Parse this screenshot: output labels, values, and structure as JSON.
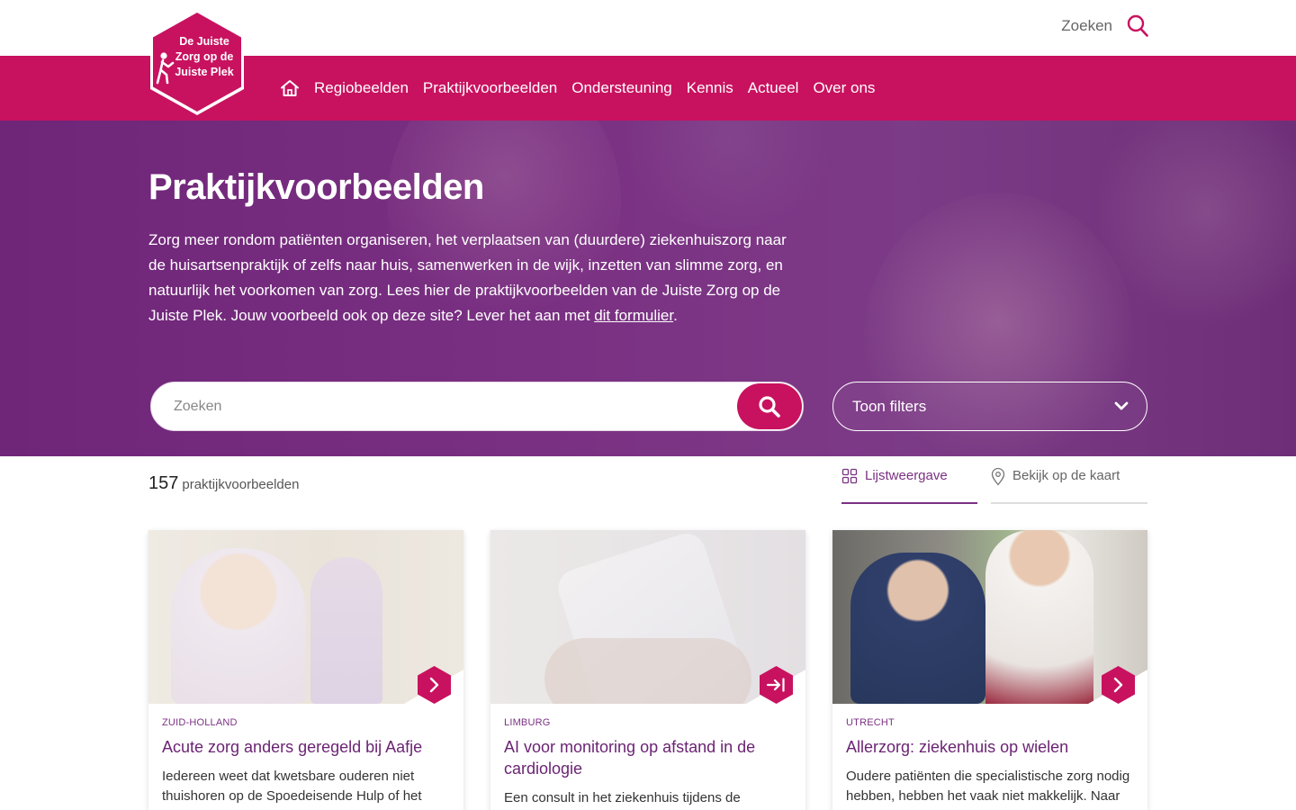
{
  "header": {
    "search_label": "Zoeken",
    "logo_lines": [
      "De Juiste",
      "Zorg op de",
      "Juiste Plek"
    ]
  },
  "nav": {
    "items": [
      {
        "label": "Regiobeelden"
      },
      {
        "label": "Praktijkvoorbeelden"
      },
      {
        "label": "Ondersteuning"
      },
      {
        "label": "Kennis"
      },
      {
        "label": "Actueel"
      },
      {
        "label": "Over ons"
      }
    ]
  },
  "hero": {
    "title": "Praktijkvoorbeelden",
    "intro": "Zorg meer rondom patiënten organiseren, het verplaatsen van (duurdere) ziekenhuiszorg naar de huisartsenpraktijk of zelfs naar huis, samenwerken in de wijk, inzetten van slimme zorg, en natuurlijk het voorkomen van zorg. Lees hier de praktijkvoorbeelden van de Juiste Zorg op de Juiste Plek. Jouw voorbeeld ook op deze site? Lever het aan met ",
    "intro_link": "dit formulier",
    "intro_end": ".",
    "search_placeholder": "Zoeken",
    "filter_label": "Toon filters"
  },
  "results": {
    "count": "157",
    "count_label": "praktijkvoorbeelden",
    "tab_list": "Lijstweergave",
    "tab_map": "Bekijk op de kaart"
  },
  "cards": [
    {
      "region": "ZUID-HOLLAND",
      "title": "Acute zorg anders geregeld bij Aafje",
      "desc": "Iedereen weet dat kwetsbare ouderen niet thuishoren op de Spoedeisende Hulp of het"
    },
    {
      "region": "LIMBURG",
      "title": "AI voor monitoring op afstand in de cardiologie",
      "desc": "Een consult in het ziekenhuis tijdens de"
    },
    {
      "region": "UTRECHT",
      "title": "Allerzorg: ziekenhuis op wielen",
      "desc": "Oudere patiënten die specialistische zorg nodig hebben, hebben het vaak niet makkelijk. Naar"
    }
  ],
  "colors": {
    "brand_pink": "#c8125f",
    "brand_purple": "#7b3183",
    "title_purple": "#6b2473"
  },
  "icons": {
    "home": "home-icon",
    "search": "search-icon",
    "chevron": "chevron-down-icon",
    "grid": "grid-icon",
    "pin": "map-pin-icon",
    "arrow": "chevron-right-icon",
    "external": "arrow-to-end-icon"
  }
}
